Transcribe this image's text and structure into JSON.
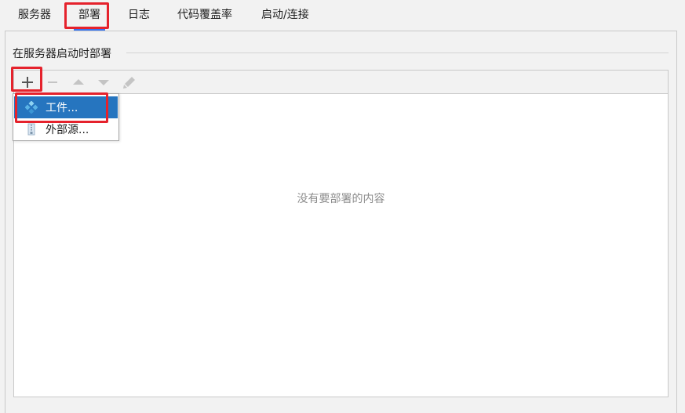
{
  "tabs": [
    {
      "label": "服务器",
      "active": false
    },
    {
      "label": "部署",
      "active": true
    },
    {
      "label": "日志",
      "active": false
    },
    {
      "label": "代码覆盖率",
      "active": false
    },
    {
      "label": "启动/连接",
      "active": false
    }
  ],
  "section": {
    "title": "在服务器启动时部署"
  },
  "toolbar": {
    "buttons": [
      {
        "icon": "plus-icon",
        "enabled": true
      },
      {
        "icon": "minus-icon",
        "enabled": false
      },
      {
        "icon": "arrow-up-icon",
        "enabled": false
      },
      {
        "icon": "arrow-down-icon",
        "enabled": false
      },
      {
        "icon": "pencil-icon",
        "enabled": false
      }
    ]
  },
  "add_menu": {
    "items": [
      {
        "label": "工件...",
        "icon": "artifact-icon",
        "selected": true
      },
      {
        "label": "外部源...",
        "icon": "external-source-icon",
        "selected": false
      }
    ]
  },
  "deploy_list": {
    "empty_text": "没有要部署的内容"
  },
  "colors": {
    "accent": "#3574f0",
    "highlight": "#e5222c",
    "menu_selected": "#2675bf",
    "disabled_icon": "#c4c4c4"
  }
}
